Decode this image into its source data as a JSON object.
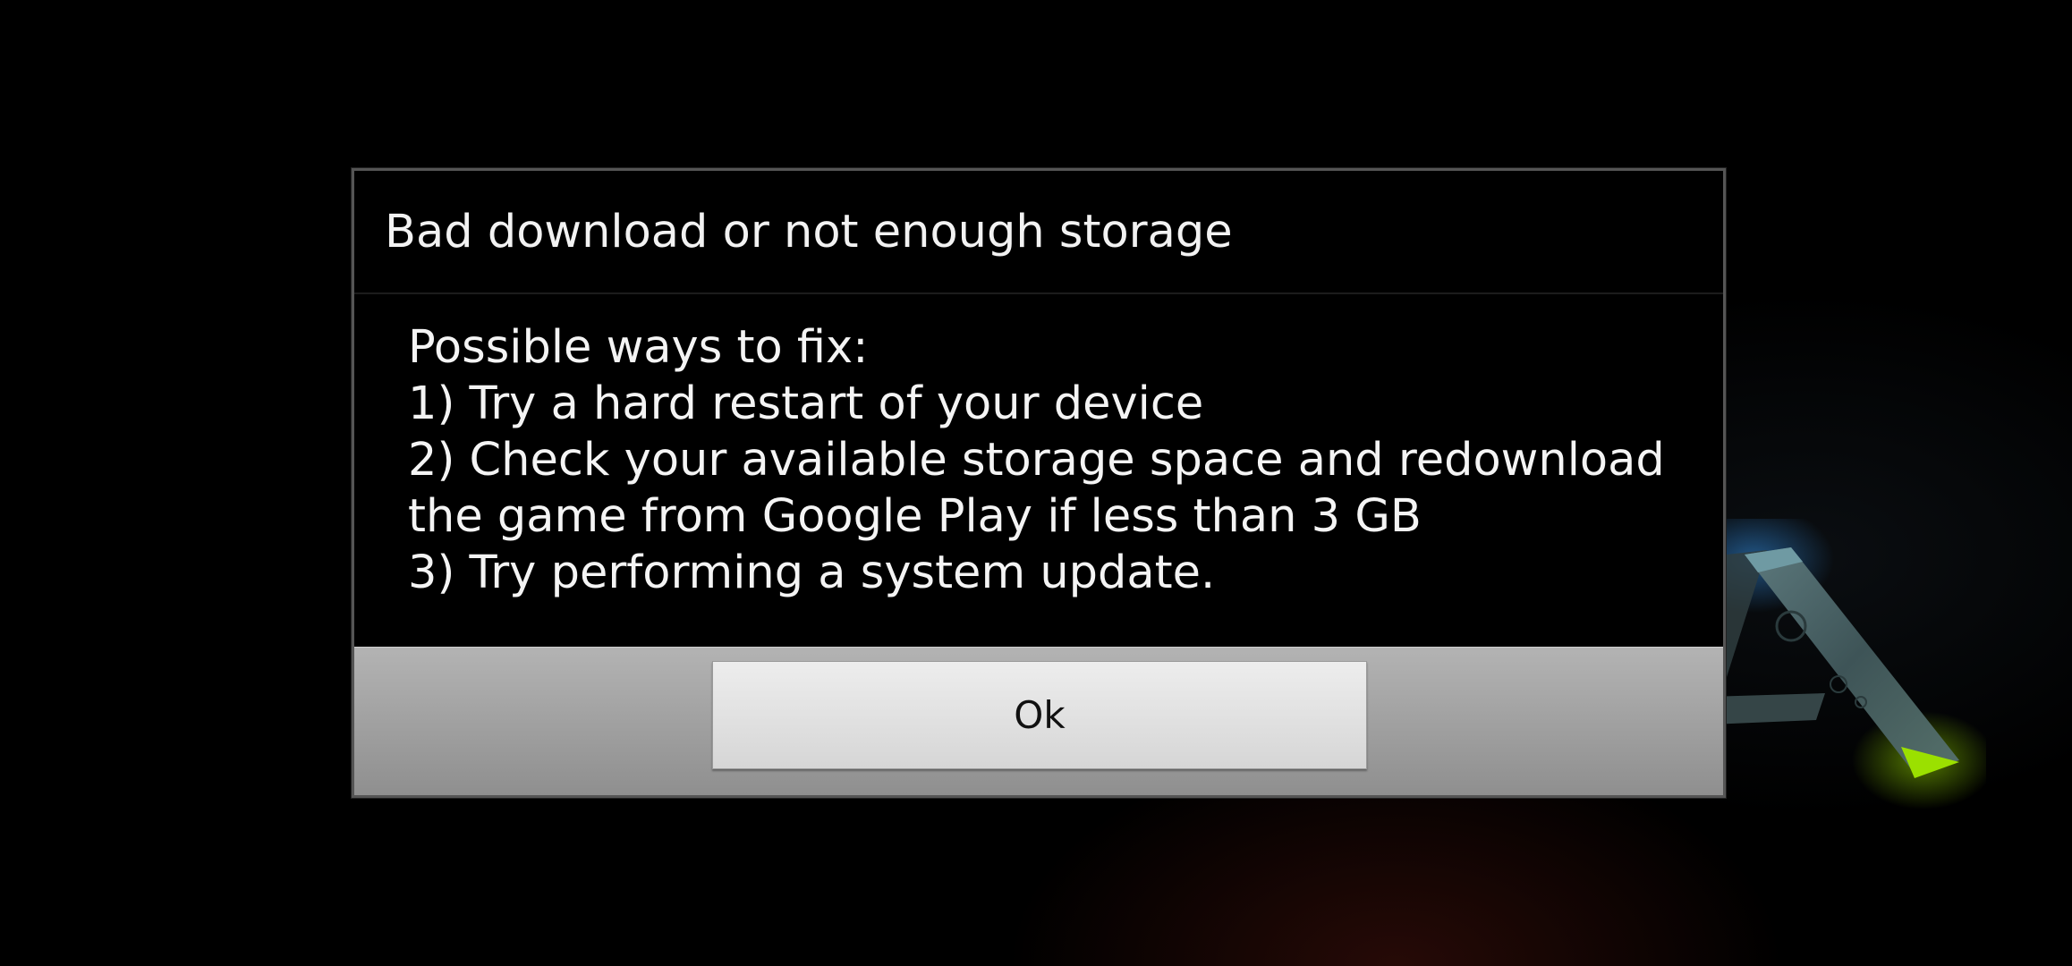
{
  "dialog": {
    "title": "Bad download or not enough storage",
    "body_lines": [
      "Possible ways to fix:",
      "1) Try a hard restart of your device",
      "2) Check your available storage space and redownload",
      "the game from Google Play if less than 3 GB",
      "3) Try performing a system update."
    ],
    "ok_label": "Ok"
  },
  "background": {
    "logo_icon": "ark-logo-icon",
    "colors": {
      "base": "#000000",
      "logo_stone": "#4f6b6e",
      "logo_blue_glow": "#3aa0ff",
      "logo_green_tip": "#9be000"
    }
  }
}
